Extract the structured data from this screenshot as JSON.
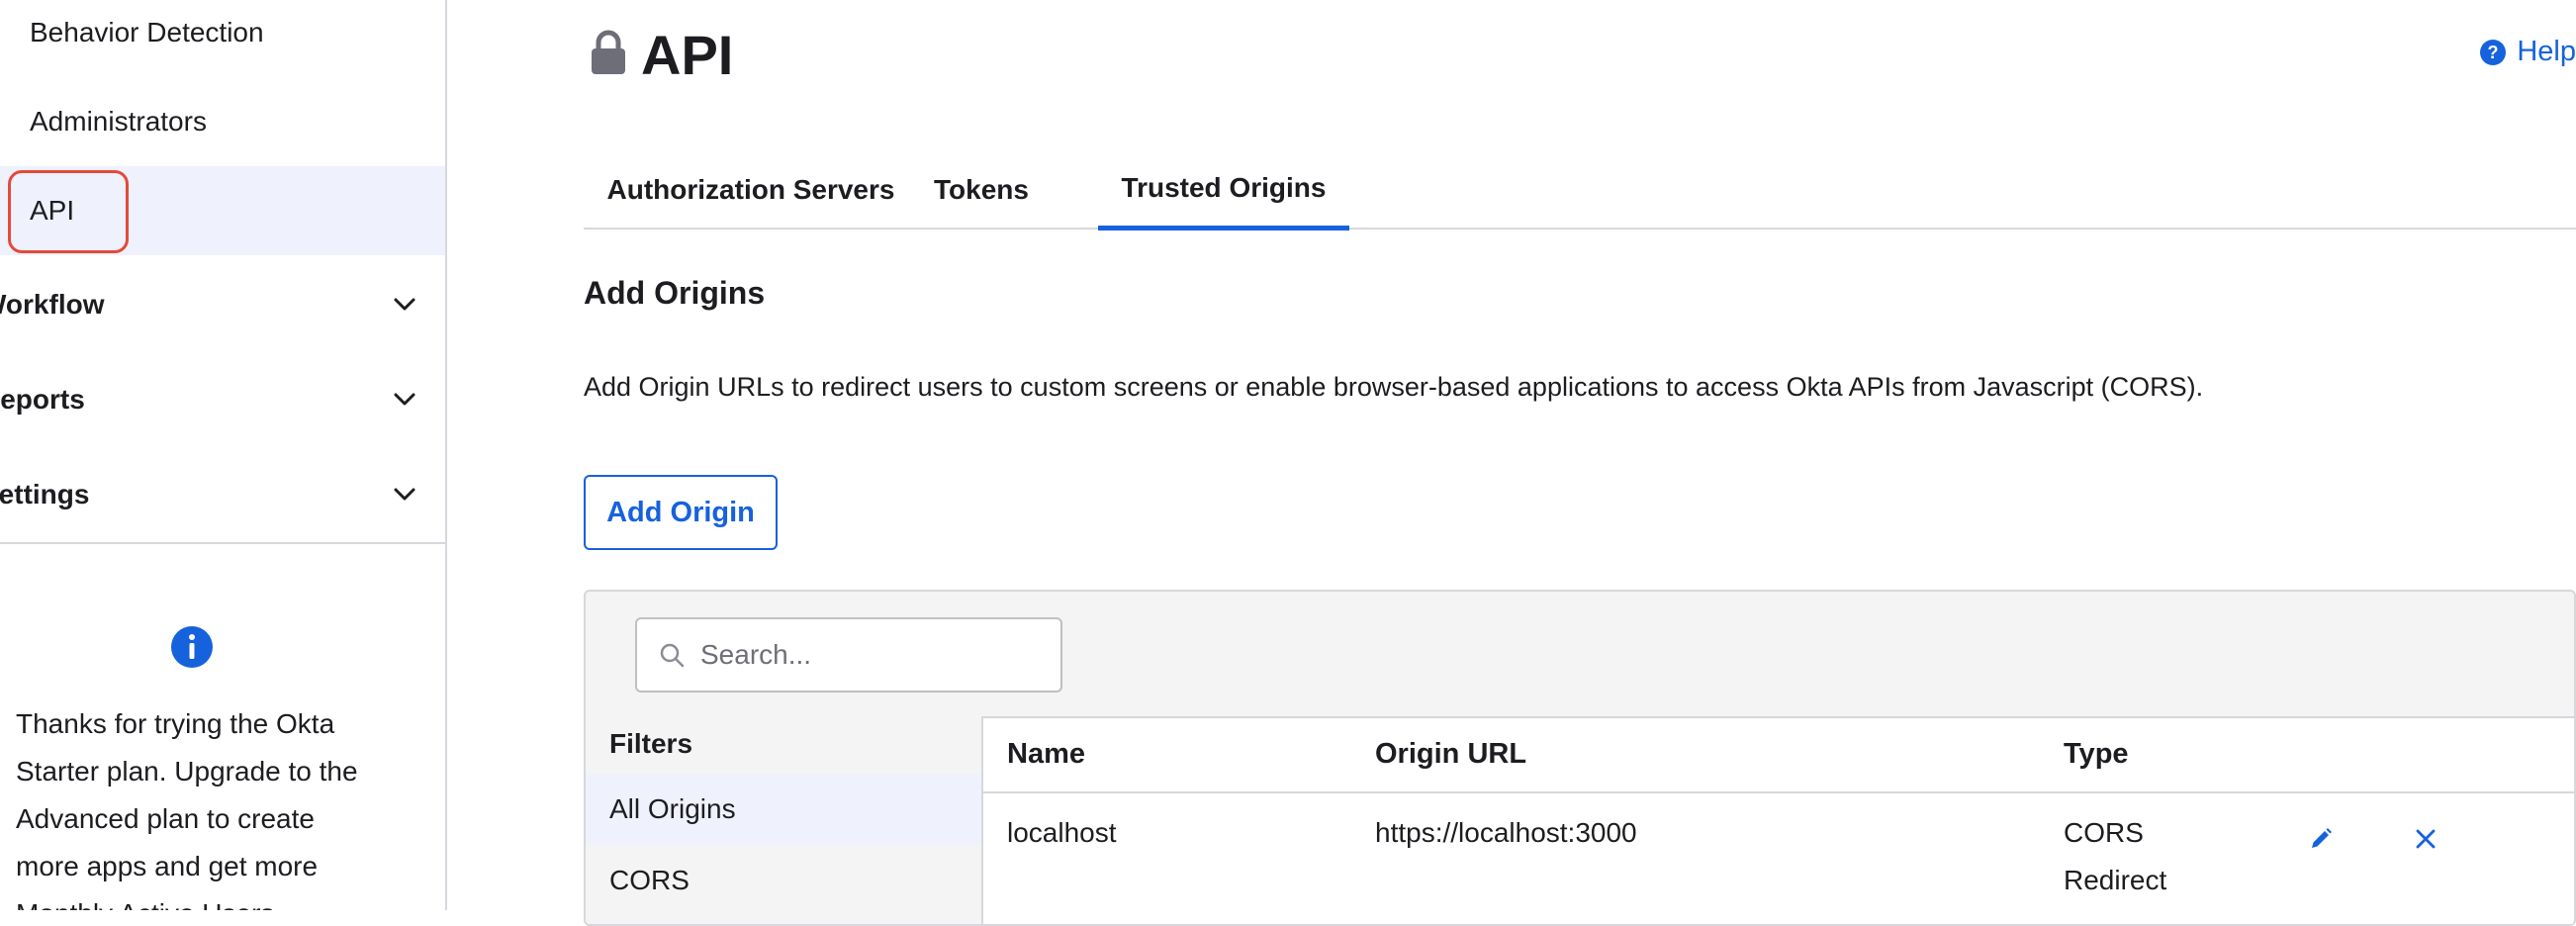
{
  "sidebar": {
    "items": [
      {
        "label": "Behavior Detection"
      },
      {
        "label": "Administrators"
      },
      {
        "label": "API"
      }
    ],
    "groups": [
      {
        "label": "Workflow"
      },
      {
        "label": "Reports"
      },
      {
        "label": "Settings"
      }
    ],
    "promo_text": "Thanks for trying the Okta Starter plan. Upgrade to the Advanced plan to create more apps and get more Monthly Active Users"
  },
  "header": {
    "title": "API",
    "help_label": "Help"
  },
  "tabs": [
    {
      "label": "Authorization Servers",
      "active": false
    },
    {
      "label": "Tokens",
      "active": false
    },
    {
      "label": "Trusted Origins",
      "active": true
    }
  ],
  "section": {
    "title": "Add Origins",
    "description": "Add Origin URLs to redirect users to custom screens or enable browser-based applications to access Okta APIs from Javascript (CORS).",
    "add_button_label": "Add Origin"
  },
  "search": {
    "placeholder": "Search...",
    "value": ""
  },
  "filters": {
    "title": "Filters",
    "items": [
      {
        "label": "All Origins",
        "selected": true
      },
      {
        "label": "CORS",
        "selected": false
      }
    ]
  },
  "table": {
    "columns": [
      "Name",
      "Origin URL",
      "Type"
    ],
    "rows": [
      {
        "name": "localhost",
        "origin_url": "https://localhost:3000",
        "type": [
          "CORS",
          "Redirect"
        ]
      }
    ]
  },
  "icons": {
    "lock": "lock-icon",
    "help": "help-circle-icon",
    "info": "info-icon",
    "search": "search-icon",
    "edit": "pencil-icon",
    "delete": "close-icon",
    "chevron": "chevron-down-icon"
  },
  "colors": {
    "accent": "#1662dd",
    "highlight_ring": "#e34a3a",
    "active_bg": "#eff1fc"
  }
}
